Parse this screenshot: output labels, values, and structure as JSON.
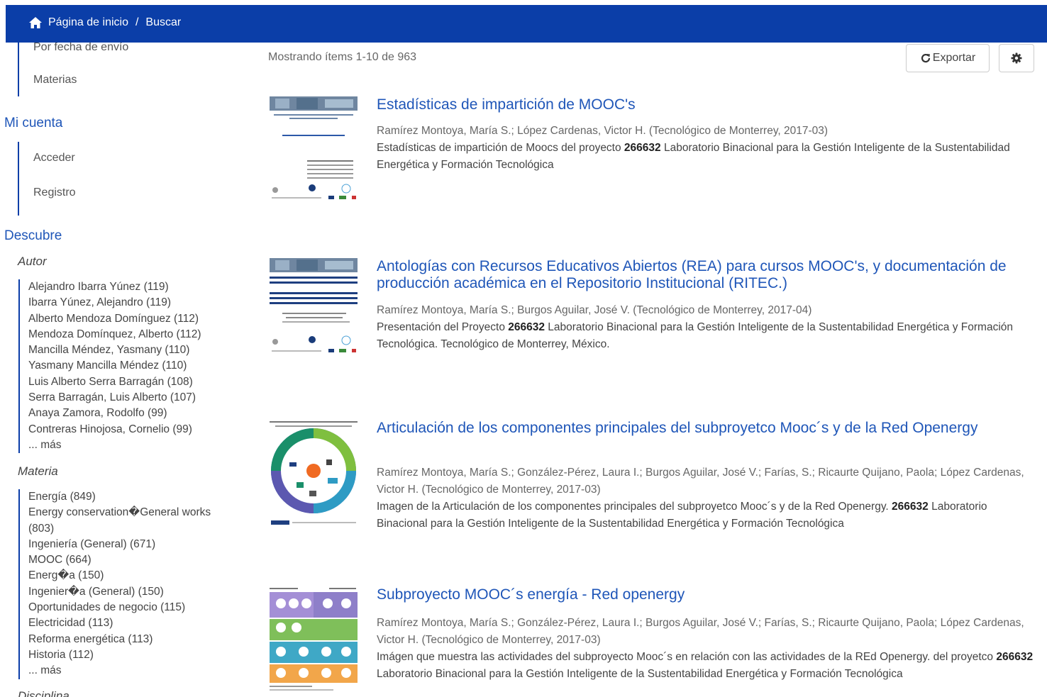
{
  "header": {
    "home_label": "Página de inicio",
    "separator": "/",
    "current": "Buscar"
  },
  "sidebar": {
    "partial_item": "Por fecha de envío",
    "materias_label": "Materias",
    "account_head": "Mi cuenta",
    "login_label": "Acceder",
    "register_label": "Registro",
    "discover_head": "Descubre",
    "autor_title": "Autor",
    "autor_items": [
      "Alejandro Ibarra Yúnez (119)",
      "Ibarra Yúnez, Alejandro (119)",
      "Alberto Mendoza Domínguez (112)",
      "Mendoza Domínquez, Alberto (112)",
      "Mancilla Méndez, Yasmany (110)",
      "Yasmany Mancilla Méndez (110)",
      "Luis Alberto Serra Barragán (108)",
      "Serra Barragán, Luis Alberto (107)",
      "Anaya Zamora, Rodolfo (99)",
      "Contreras Hinojosa, Cornelio (99)",
      "... más"
    ],
    "materia_title": "Materia",
    "materia_items": [
      "Energía (849)",
      "Energy conservation�General works (803)",
      "Ingeniería (General) (671)",
      "MOOC (664)",
      "Energ�a (150)",
      "Ingenier�a (General) (150)",
      "Oportunidades de negocio (115)",
      "Electricidad (113)",
      "Reforma energética (113)",
      "Historia (112)",
      "... más"
    ],
    "disciplina_title": "Disciplina"
  },
  "main": {
    "showing_text": "Mostrando ítems 1-10 de 963",
    "export_label": "Exportar"
  },
  "results": [
    {
      "title": "Estadísticas de impartición de MOOC's",
      "meta": "Ramírez Montoya, María S.; López Cardenas, Victor H. (Tecnológico de Monterrey, 2017-03)",
      "abs_pre": "Estadísticas de impartición de Moocs del proyecto ",
      "abs_bold": "266632",
      "abs_post": " Laboratorio Binacional para la Gestión Inteligente de la Sustentabilidad Energética y Formación Tecnológica"
    },
    {
      "title": "Antologías con Recursos Educativos Abiertos (REA) para cursos MOOC's, y documentación de producción académica en el Repositorio Institucional (RITEC.)",
      "meta": "Ramírez Montoya, María S.; Burgos Aguilar, José V. (Tecnológico de Monterrey, 2017-04)",
      "abs_pre": "Presentación del Proyecto ",
      "abs_bold": "266632",
      "abs_post": " Laboratorio Binacional para la Gestión Inteligente de la Sustentabilidad Energética y Formación Tecnológica. Tecnológico de Monterrey, México."
    },
    {
      "title": "Articulación de los componentes principales del subproyetco Mooc´s y de la Red Openergy",
      "meta": "Ramírez Montoya, María S.; González-Pérez, Laura I.; Burgos Aguilar, José V.; Farías, S.; Ricaurte Quijano, Paola; López Cardenas, Victor H. (Tecnológico de Monterrey, 2017-03)",
      "abs_pre": "Imagen de la Articulación de los componentes principales del subproyetco Mooc´s y de la Red Openergy. ",
      "abs_bold": "266632",
      "abs_post": " Laboratorio Binacional para la Gestión Inteligente de la Sustentabilidad Energética y Formación Tecnológica"
    },
    {
      "title": "Subproyecto MOOC´s energía - Red openergy",
      "meta": "Ramírez Montoya, María S.; González-Pérez, Laura I.; Burgos Aguilar, José V.; Farías, S.; Ricaurte Quijano, Paola; López Cardenas, Victor H. (Tecnológico de Monterrey, 2017-03)",
      "abs_pre": "Imágen que muestra las actividades del subproyecto Mooc´s en relación con las actividades de la REd Openergy. del proyetco ",
      "abs_bold": "266632",
      "abs_post": " Laboratorio Binacional para la Gestión Inteligente de la Sustentabilidad Energética y Formación Tecnológica"
    }
  ],
  "colors": {
    "primary": "#0b3ea8",
    "link": "#1f56b8"
  }
}
